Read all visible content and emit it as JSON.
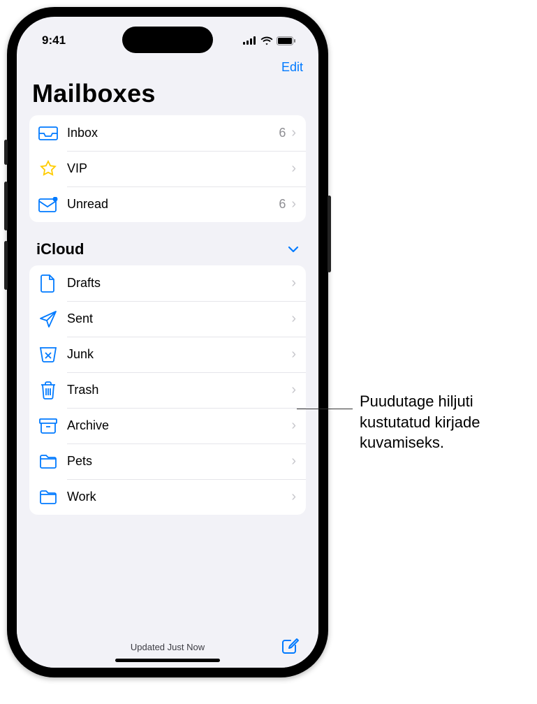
{
  "status": {
    "time": "9:41"
  },
  "nav": {
    "edit": "Edit"
  },
  "page": {
    "title": "Mailboxes"
  },
  "smart": [
    {
      "label": "Inbox",
      "count": "6",
      "icon": "inbox"
    },
    {
      "label": "VIP",
      "count": "",
      "icon": "star"
    },
    {
      "label": "Unread",
      "count": "6",
      "icon": "unread"
    }
  ],
  "section": {
    "title": "iCloud"
  },
  "folders": [
    {
      "label": "Drafts",
      "icon": "document"
    },
    {
      "label": "Sent",
      "icon": "paperplane"
    },
    {
      "label": "Junk",
      "icon": "junk"
    },
    {
      "label": "Trash",
      "icon": "trash"
    },
    {
      "label": "Archive",
      "icon": "archive"
    },
    {
      "label": "Pets",
      "icon": "folder"
    },
    {
      "label": "Work",
      "icon": "folder"
    }
  ],
  "toolbar": {
    "status": "Updated Just Now"
  },
  "callout": {
    "text": "Puudutage hiljuti kustutatud kirjade kuvamiseks."
  }
}
